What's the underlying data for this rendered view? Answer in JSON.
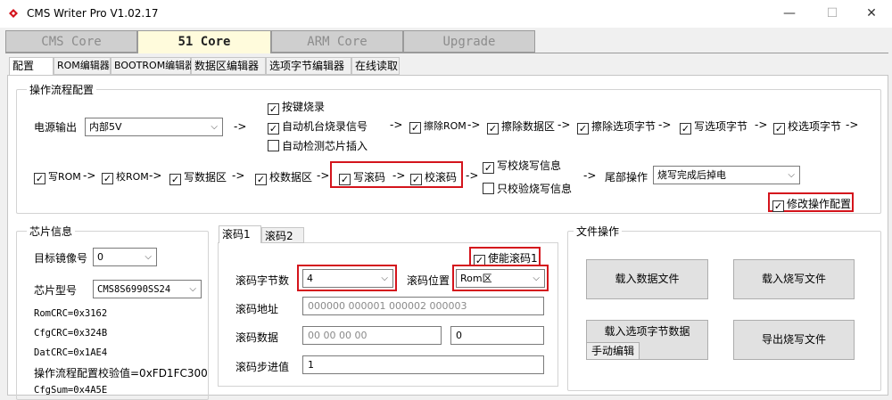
{
  "window": {
    "title": "CMS Writer Pro V1.02.17",
    "minimize": "—",
    "maximize": "☐",
    "close": "✕",
    "icon": "app-logo-icon"
  },
  "main_tabs": [
    "CMS Core",
    "51 Core",
    "ARM Core",
    "Upgrade"
  ],
  "sub_tabs": [
    "配置",
    "ROM编辑器",
    "BOOTROM编辑器",
    "数据区编辑器",
    "选项字节编辑器",
    "在线读取"
  ],
  "flow": {
    "title": "操作流程配置",
    "power_label": "电源输出",
    "power_value": "内部5V",
    "arrow": "->",
    "key_burn": "按键烧录",
    "auto_signal": "自动机台烧录信号",
    "auto_detect": "自动检测芯片插入",
    "steps1": [
      "擦除ROM",
      "擦除数据区",
      "擦除选项字节",
      "写选项字节",
      "校选项字节"
    ],
    "steps2": [
      "写ROM",
      "校ROM",
      "写数据区",
      "校数据区",
      "写滚码",
      "校滚码"
    ],
    "write_verify_info": "写校烧写信息",
    "verify_only_info": "只校验烧写信息",
    "tail_label": "尾部操作",
    "tail_value": "烧写完成后掉电",
    "modify_flow": "修改操作配置"
  },
  "chip": {
    "title": "芯片信息",
    "mirror_label": "目标镜像号",
    "mirror_value": "0",
    "model_label": "芯片型号",
    "model_value": "CMS8S6990SS24",
    "rom_crc": "RomCRC=0x3162",
    "cfg_crc": "CfgCRC=0x324B",
    "dat_crc": "DatCRC=0x1AE4",
    "flow_checksum": "操作流程配置校验值=0xFD1FC300",
    "cfg_sum": "CfgSum=0x4A5E"
  },
  "rolling": {
    "tabs": [
      "滚码1",
      "滚码2"
    ],
    "enable": "使能滚码1",
    "bytes_label": "滚码字节数",
    "bytes_value": "4",
    "pos_label": "滚码位置",
    "pos_value": "Rom区",
    "addr_label": "滚码地址",
    "addr_placeholder": "000000 000001 000002 000003",
    "data_label": "滚码数据",
    "data_placeholder": "00 00 00 00",
    "data_value2": "0",
    "step_label": "滚码步进值",
    "step_value": "1"
  },
  "file_ops": {
    "title": "文件操作",
    "load_data": "载入数据文件",
    "load_burn": "载入烧写文件",
    "load_option": "载入选项字节数据",
    "manual_edit": "手动编辑",
    "export_burn": "导出烧写文件"
  },
  "colors": {
    "highlight": "#d4141c",
    "active_tab": "#fffbdc"
  }
}
